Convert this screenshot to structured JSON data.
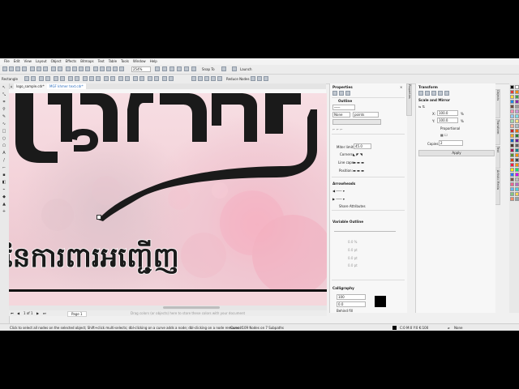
{
  "menu": [
    "File",
    "Edit",
    "View",
    "Layout",
    "Object",
    "Effects",
    "Bitmaps",
    "Text",
    "Table",
    "Tools",
    "Window",
    "Help"
  ],
  "toolbar": {
    "zoom": "254%",
    "snap_label": "Snap To",
    "launch_label": "Launch"
  },
  "propbar": {
    "object_type": "Rectangle",
    "reduce_nodes_label": "Reduce Nodes"
  },
  "tabs": [
    {
      "label": "Welcome Screen"
    },
    {
      "label": "logo_sample.cdr*"
    },
    {
      "label": "MGF khmer text.cdr*"
    }
  ],
  "canvas": {
    "khmer_title": "បុគ្គលិក",
    "khmer_line": "នៃការពារអញ្ជើញ"
  },
  "page": {
    "nav_label": "Page 1"
  },
  "canvas_hint": "Drag colors (or objects) here to store these colors with your document",
  "properties": {
    "title": "Properties",
    "outline_label": "Outline",
    "width_value": "None",
    "units": "points",
    "miter_label": "Miter limit:",
    "miter_value": "45.0",
    "corners_label": "Corners:",
    "line_caps_label": "Line caps:",
    "position_label": "Position:",
    "arrowheads_label": "Arrowheads",
    "share_attr_label": "Share Attributes",
    "variable_outline_label": "Variable Outline",
    "vo_values": [
      "0.0 %",
      "0.0 pt",
      "0.0 pt",
      "0.0 pt"
    ],
    "calligraphy_label": "Calligraphy",
    "stretch_value": "100",
    "angle_value": "0.0",
    "behind_fill_label": "Behind fill",
    "scale_label": "Scale with object"
  },
  "transform": {
    "title": "Transform",
    "section": "Scale and Mirror",
    "x_label": "X:",
    "x_value": "100.0",
    "y_label": "Y:",
    "y_value": "100.0",
    "percent": "%",
    "proportional_label": "Proportional",
    "copies_label": "Copies:",
    "copies_value": "2",
    "apply_label": "Apply"
  },
  "docker_tabs": [
    "Properties",
    "Objects",
    "Transform",
    "Text",
    "Artistic Media"
  ],
  "status": {
    "hint": "Click to select all nodes on the selected object; Shift+click multi-selects; dbl-clicking on a curve adds a node; dbl-clicking on a node removes it",
    "curve_info": "Curve: 109 Nodes on 7 Subpaths",
    "fill_info": "C:0 M:0 Y:0 K:100",
    "outline_info": "None"
  },
  "colors": {
    "accent": "#2f6fbf",
    "canvas_pink": "#f3d2d9",
    "ink": "#111111"
  },
  "palette": [
    "#000000",
    "#ffffff",
    "#e53935",
    "#fb8c00",
    "#fdd835",
    "#43a047",
    "#1e88e5",
    "#8e24aa",
    "#6d4c41",
    "#9e9e9e",
    "#f48fb1",
    "#ce93d8",
    "#90caf9",
    "#80deea",
    "#a5d6a7",
    "#ffe082",
    "#ffab91",
    "#b0bec5",
    "#c62828",
    "#ef6c00",
    "#f9a825",
    "#2e7d32",
    "#1565c0",
    "#6a1b9a",
    "#4e342e",
    "#616161",
    "#ad1457",
    "#00838f",
    "#558b2f",
    "#ff8f00",
    "#d84315",
    "#37474f",
    "#ff1744",
    "#ff9100",
    "#ffea00",
    "#00e676",
    "#2979ff",
    "#d500f9",
    "#795548",
    "#bdbdbd",
    "#f06292",
    "#ba68c8",
    "#64b5f6",
    "#4dd0e1",
    "#81c784",
    "#ffd54f",
    "#ff8a65",
    "#90a4ae"
  ]
}
